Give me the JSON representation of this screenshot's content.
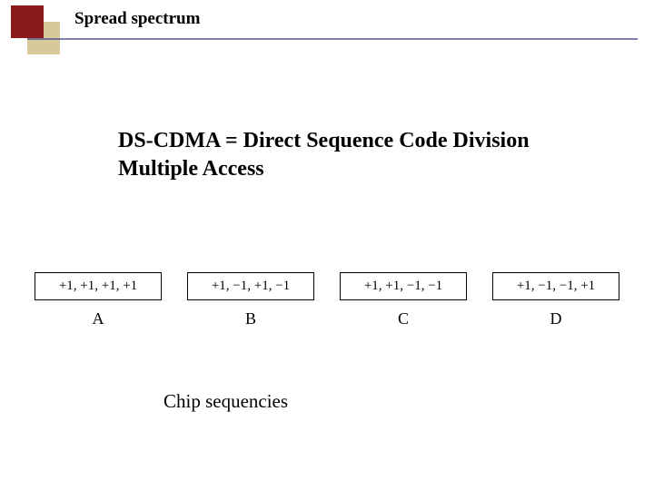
{
  "header": {
    "title": "Spread spectrum"
  },
  "main": {
    "heading": "DS-CDMA = Direct Sequence Code Division Multiple Access",
    "caption": "Chip sequencies"
  },
  "chips": [
    {
      "seq": "+1, +1, +1, +1",
      "label": "A"
    },
    {
      "seq": "+1, −1, +1, −1",
      "label": "B"
    },
    {
      "seq": "+1, +1, −1, −1",
      "label": "C"
    },
    {
      "seq": "+1, −1, −1, +1",
      "label": "D"
    }
  ]
}
